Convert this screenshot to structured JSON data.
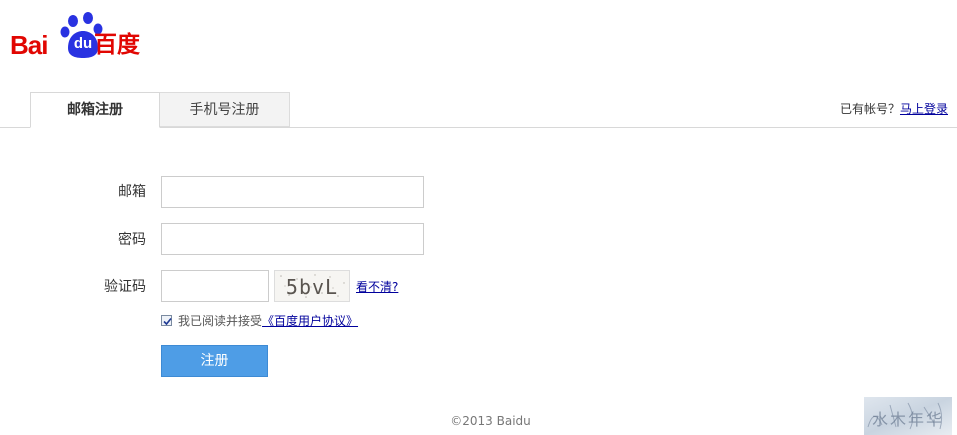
{
  "logo": {
    "word": "Bai",
    "paw_text": "du",
    "cn": "百度",
    "brand_red": "#e10602",
    "paw_blue": "#2932e1"
  },
  "tabs": [
    {
      "label": "邮箱注册",
      "active": true
    },
    {
      "label": "手机号注册",
      "active": false
    }
  ],
  "login_hint": {
    "text": "已有帐号？",
    "link": "马上登录"
  },
  "form": {
    "email_label": "邮箱",
    "email_value": "",
    "password_label": "密码",
    "password_value": "",
    "captcha_label": "验证码",
    "captcha_value": "",
    "captcha_image_text": "5bvL",
    "captcha_refresh": "看不清?"
  },
  "agreement": {
    "checked": true,
    "text": "我已阅读并接受",
    "link": "《百度用户协议》"
  },
  "submit_label": "注册",
  "accent_blue": "#4e9de6",
  "footer": "©2013 Baidu",
  "watermark_text": "水木年华"
}
